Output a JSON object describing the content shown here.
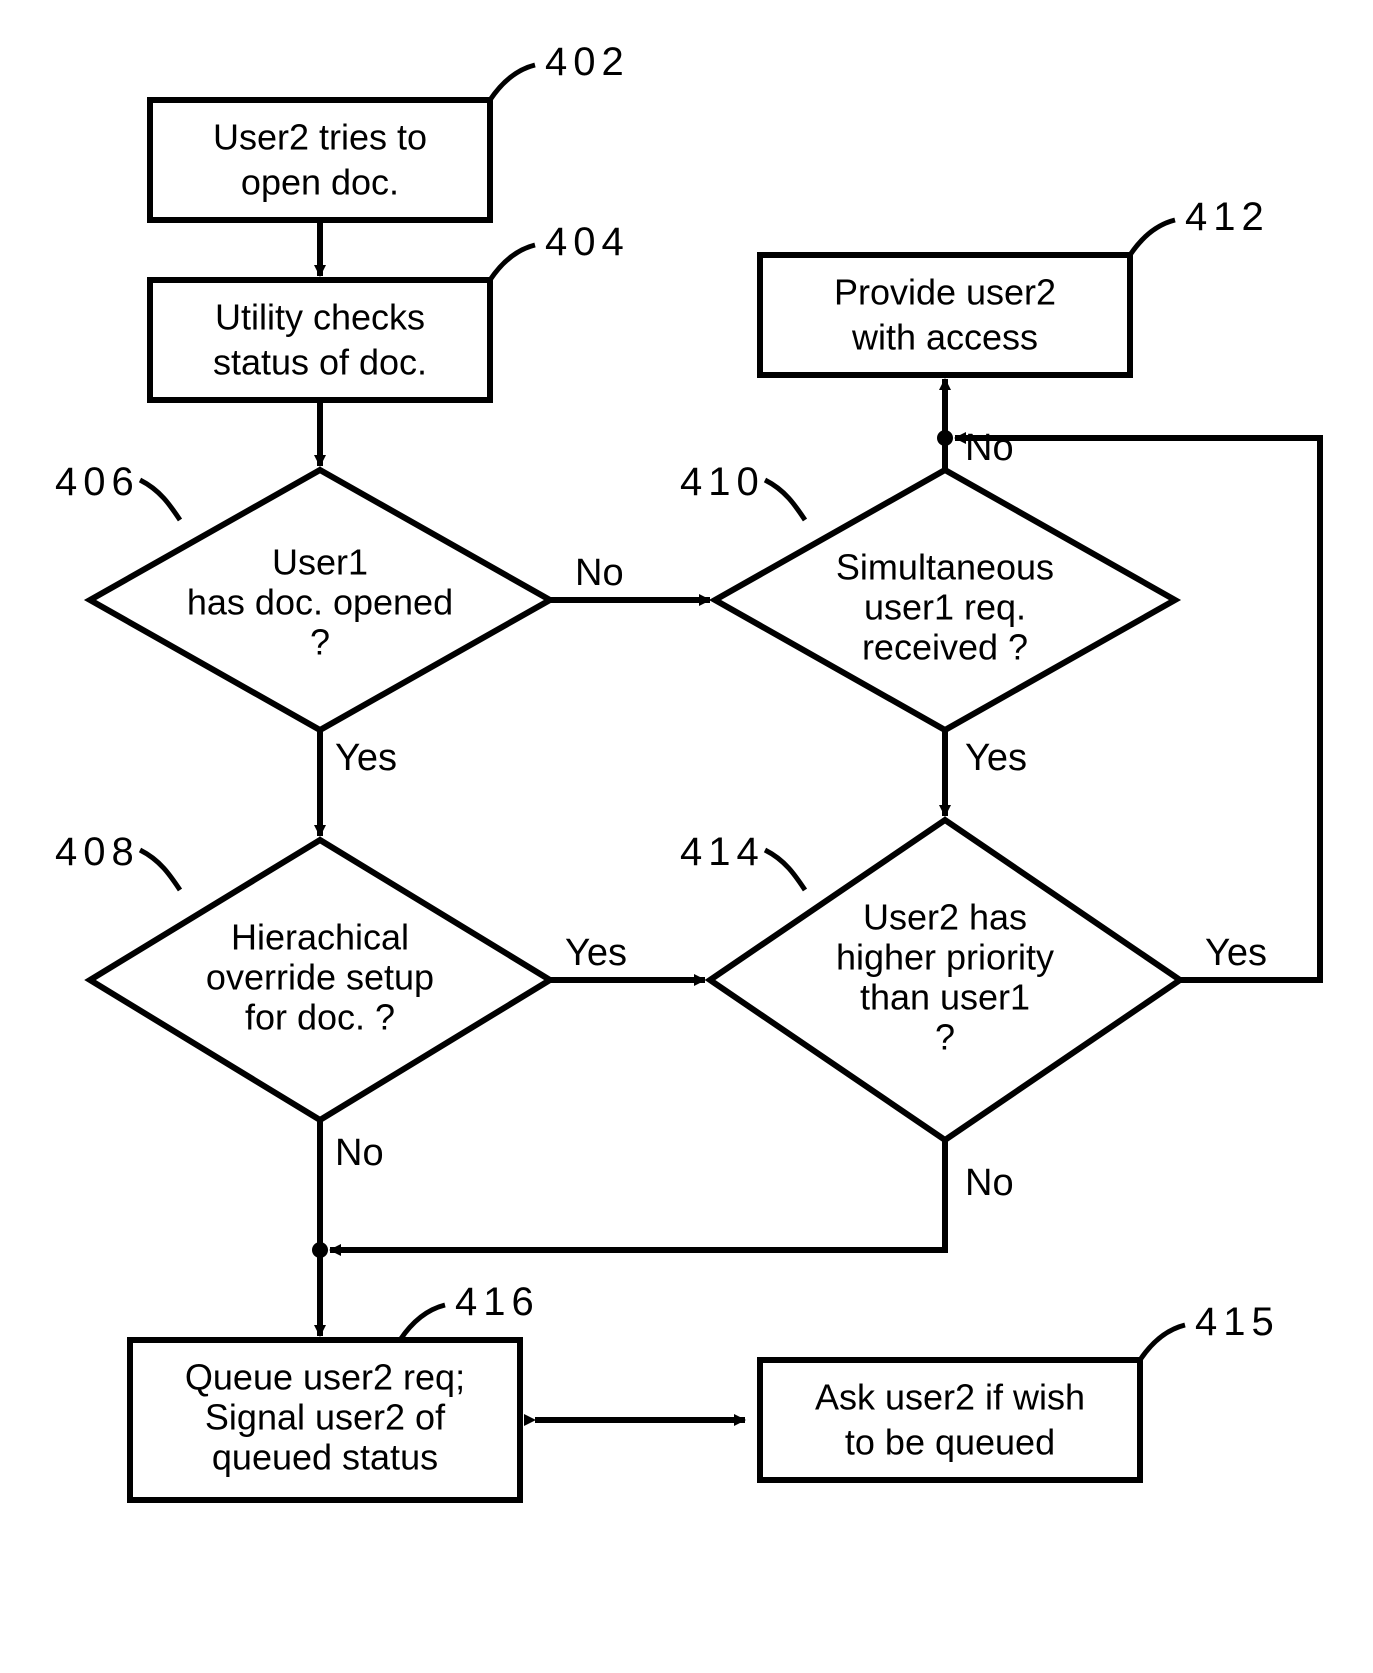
{
  "refs": {
    "n402": "402",
    "n404": "404",
    "n406": "406",
    "n408": "408",
    "n410": "410",
    "n412": "412",
    "n414": "414",
    "n415": "415",
    "n416": "416"
  },
  "nodes": {
    "n402": {
      "l1": "User2 tries to",
      "l2": "open doc."
    },
    "n404": {
      "l1": "Utility checks",
      "l2": "status of doc."
    },
    "n406": {
      "l1": "User1",
      "l2": "has doc. opened",
      "l3": "?"
    },
    "n408": {
      "l1": "Hierachical",
      "l2": "override setup",
      "l3": "for doc. ?"
    },
    "n410": {
      "l1": "Simultaneous",
      "l2": "user1 req.",
      "l3": "received ?"
    },
    "n412": {
      "l1": "Provide user2",
      "l2": "with access"
    },
    "n414": {
      "l1": "User2 has",
      "l2": "higher priority",
      "l3": "than user1",
      "l4": "?"
    },
    "n415": {
      "l1": "Ask user2 if wish",
      "l2": "to be queued"
    },
    "n416": {
      "l1": "Queue user2 req;",
      "l2": "Signal user2 of",
      "l3": "queued status"
    }
  },
  "edges": {
    "yes": "Yes",
    "no": "No"
  }
}
